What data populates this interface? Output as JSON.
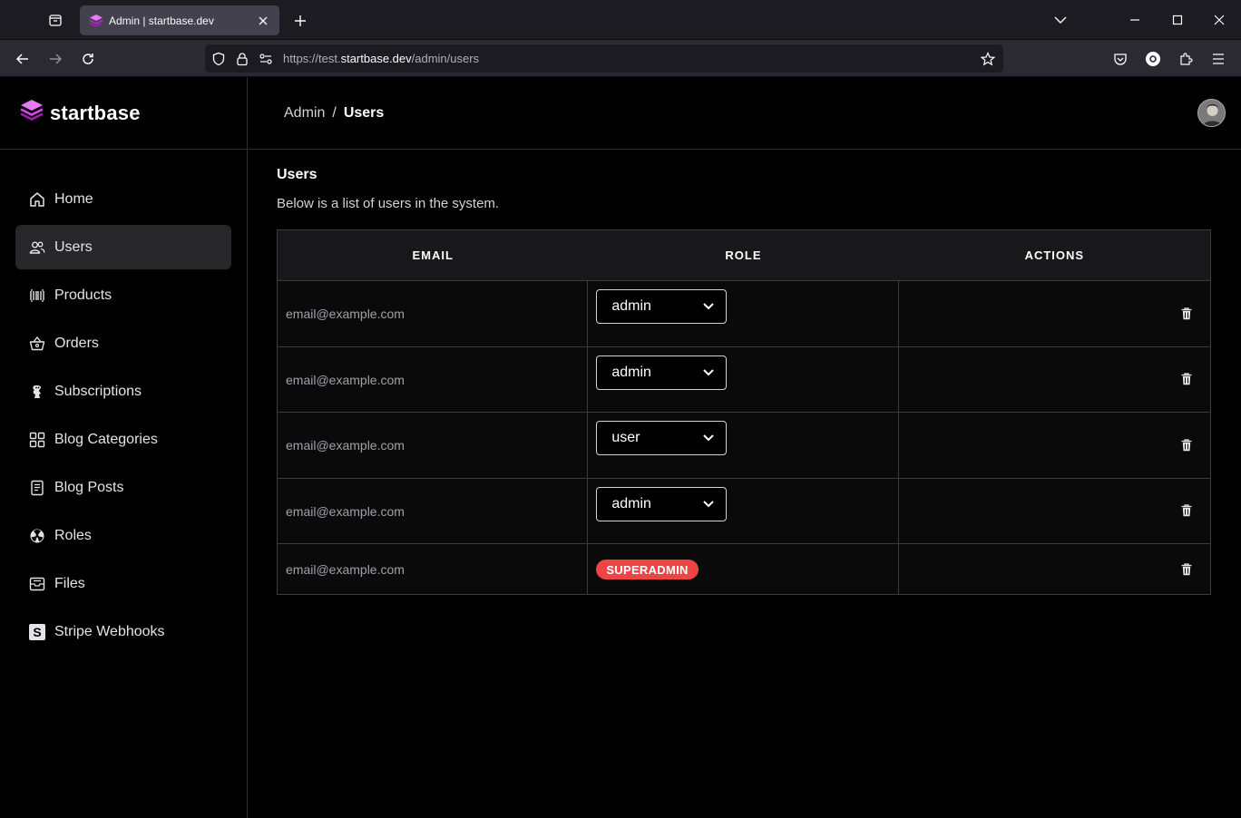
{
  "browser": {
    "tab_title": "Admin | startbase.dev",
    "url_prefix": "https://test.",
    "url_domain": "startbase.dev",
    "url_path": "/admin/users"
  },
  "brand": {
    "name": "startbase",
    "accent": "#c026d3"
  },
  "sidebar": {
    "items": [
      {
        "label": "Home",
        "icon": "home-icon"
      },
      {
        "label": "Users",
        "icon": "users-icon",
        "active": true
      },
      {
        "label": "Products",
        "icon": "barcode-icon"
      },
      {
        "label": "Orders",
        "icon": "basket-icon"
      },
      {
        "label": "Subscriptions",
        "icon": "mascot-icon"
      },
      {
        "label": "Blog Categories",
        "icon": "grid-icon"
      },
      {
        "label": "Blog Posts",
        "icon": "document-icon"
      },
      {
        "label": "Roles",
        "icon": "radiation-icon"
      },
      {
        "label": "Files",
        "icon": "inbox-icon"
      },
      {
        "label": "Stripe Webhooks",
        "icon": "stripe-icon"
      }
    ]
  },
  "breadcrumb": {
    "parent": "Admin",
    "separator": "/",
    "current": "Users"
  },
  "main": {
    "title": "Users",
    "description": "Below is a list of users in the system."
  },
  "table": {
    "headers": [
      "EMAIL",
      "ROLE",
      "ACTIONS"
    ],
    "rows": [
      {
        "email": "email@example.com",
        "role": "admin"
      },
      {
        "email": "email@example.com",
        "role": "admin"
      },
      {
        "email": "email@example.com",
        "role": "user"
      },
      {
        "email": "email@example.com",
        "role": "admin"
      },
      {
        "email": "email@example.com",
        "badge": "SUPERADMIN",
        "badge_color": "#ef4444"
      }
    ]
  }
}
